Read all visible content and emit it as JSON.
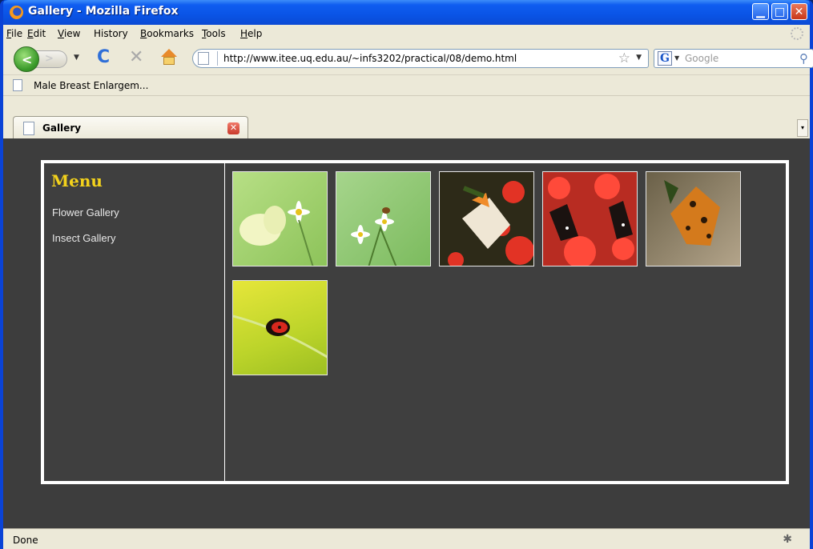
{
  "window": {
    "title": "Gallery - Mozilla Firefox"
  },
  "menubar": {
    "items": [
      {
        "label": "File",
        "key": "F",
        "rest": "ile"
      },
      {
        "label": "Edit",
        "key": "E",
        "rest": "dit"
      },
      {
        "label": "View",
        "key": "V",
        "rest": "iew"
      },
      {
        "label": "History",
        "key": "",
        "rest": "History"
      },
      {
        "label": "Bookmarks",
        "key": "B",
        "rest": "ookmarks"
      },
      {
        "label": "Tools",
        "key": "T",
        "rest": "ools"
      },
      {
        "label": "Help",
        "key": "H",
        "rest": "elp"
      }
    ]
  },
  "navbar": {
    "url": "http://www.itee.uq.edu.au/~infs3202/practical/08/demo.html",
    "search_placeholder": "Google",
    "search_engine_glyph": "G"
  },
  "bookmarks": [
    {
      "label": "Male Breast Enlargem..."
    }
  ],
  "tabs": [
    {
      "label": "Gallery",
      "active": true
    }
  ],
  "page": {
    "menu_title": "Menu",
    "menu_links": [
      "Flower Gallery",
      "Insect Gallery"
    ],
    "thumbnails": [
      {
        "name": "white-butterfly-on-daisy",
        "bg": "#9ccf6a"
      },
      {
        "name": "bee-on-white-flowers",
        "bg": "#8cc46e"
      },
      {
        "name": "white-orange-butterfly-red-flowers",
        "bg": "#c43a2a"
      },
      {
        "name": "black-butterflies-red-flowers",
        "bg": "#d2362c"
      },
      {
        "name": "orange-spotted-butterfly-on-rock",
        "bg": "#8a7a62"
      },
      {
        "name": "ladybug-on-leaf",
        "bg": "#bfd62c"
      }
    ]
  },
  "status": {
    "text": "Done"
  },
  "colors": {
    "page_bg": "#3d3d3d",
    "menu_title": "#f3d21c",
    "frame_border": "#ffffff"
  }
}
